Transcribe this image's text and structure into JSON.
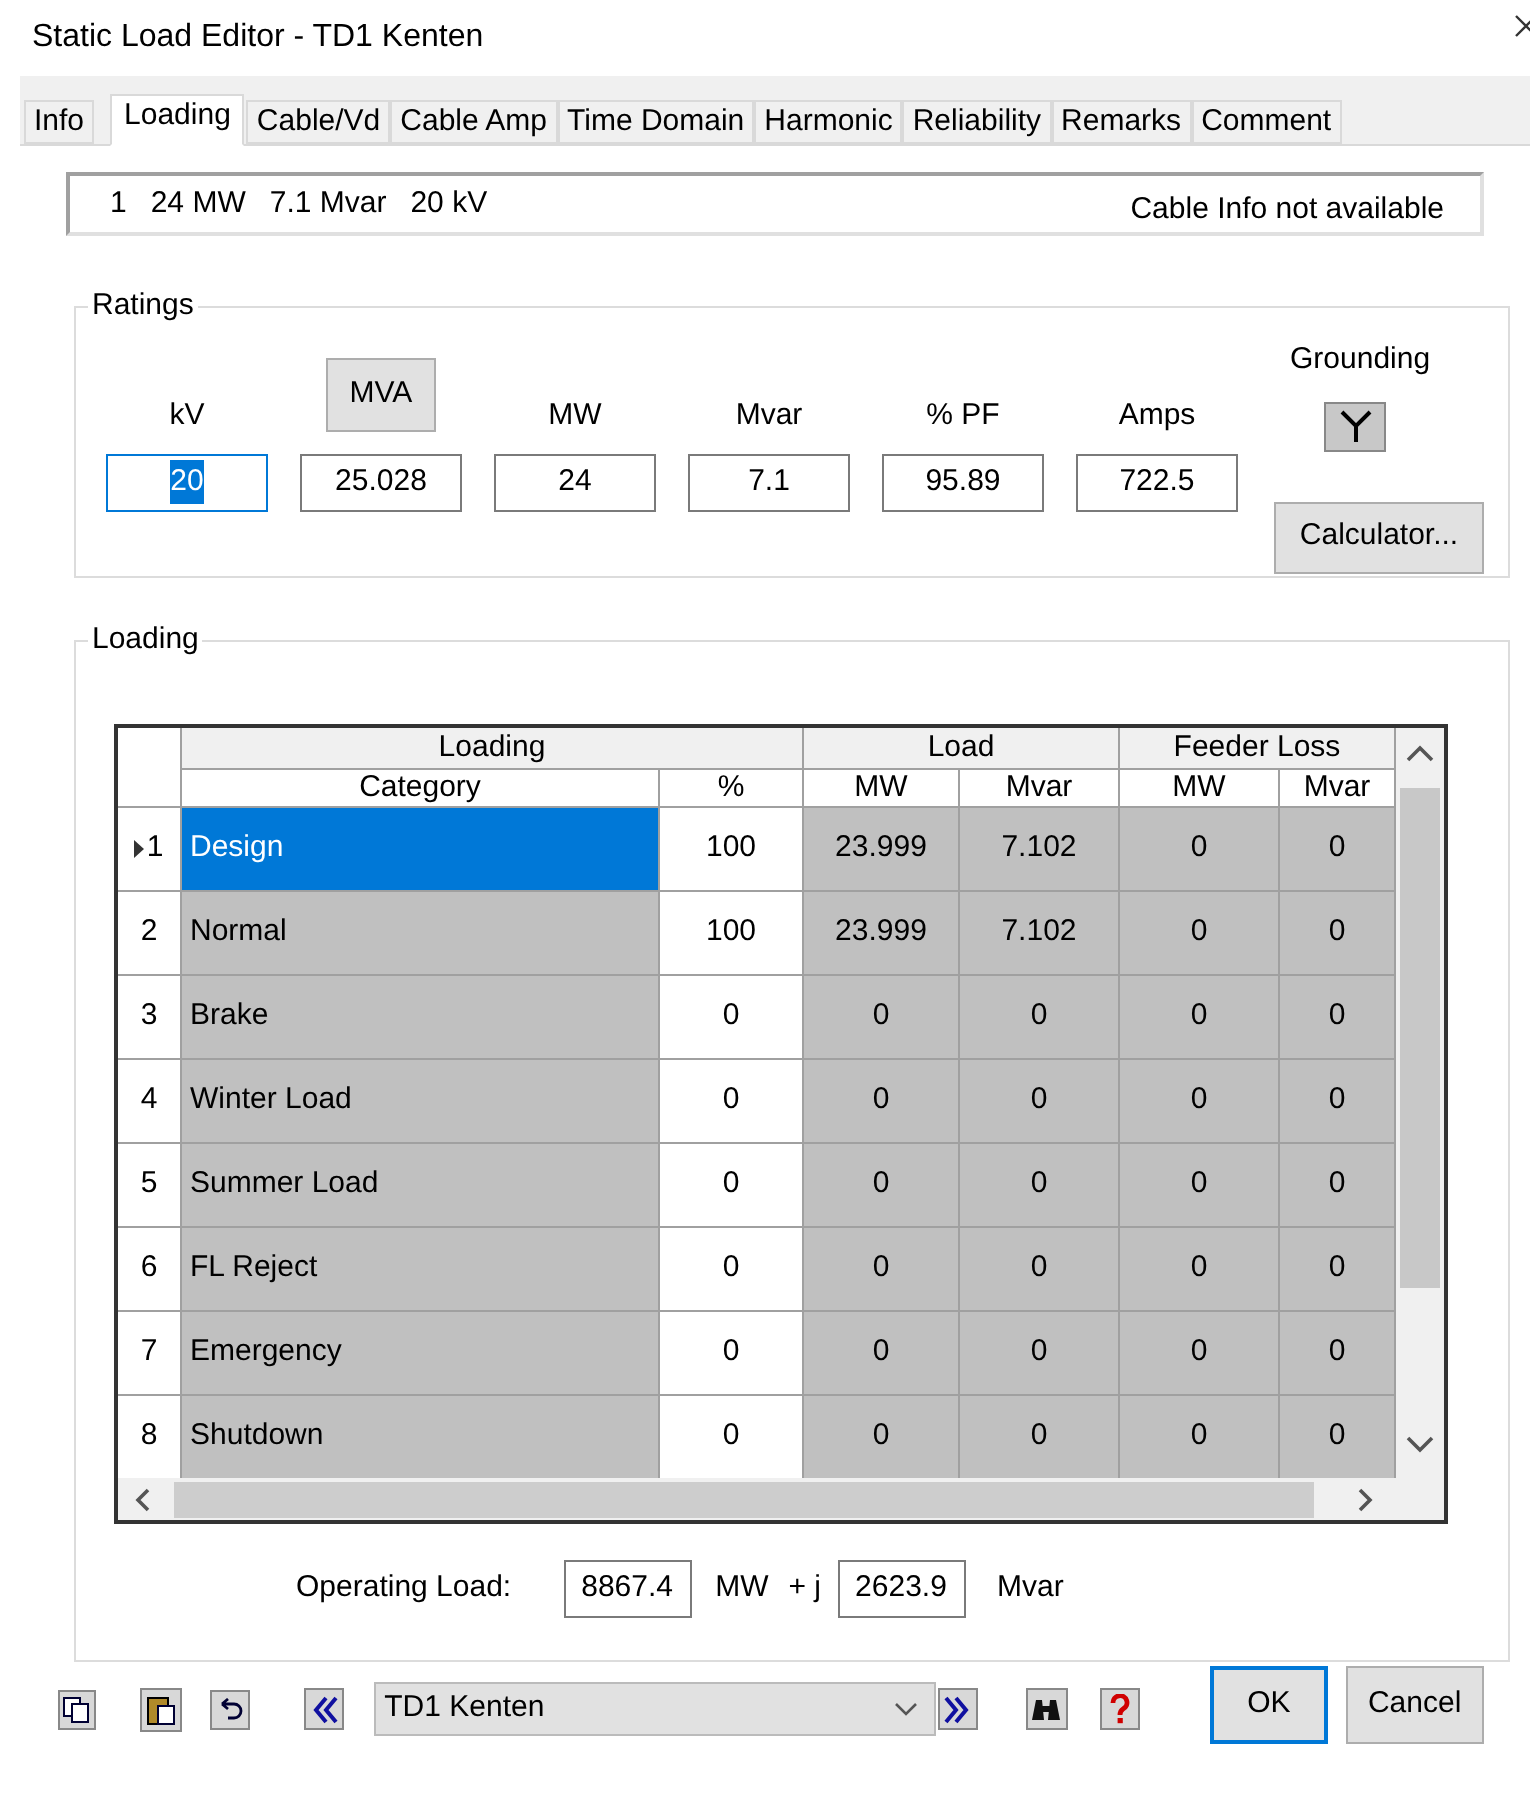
{
  "window": {
    "title": "Static Load Editor - TD1 Kenten"
  },
  "tabs": [
    {
      "label": "Info",
      "selected": false
    },
    {
      "label": "Loading",
      "selected": true
    },
    {
      "label": "Cable/Vd",
      "selected": false
    },
    {
      "label": "Cable Amp",
      "selected": false
    },
    {
      "label": "Time Domain",
      "selected": false
    },
    {
      "label": "Harmonic",
      "selected": false
    },
    {
      "label": "Reliability",
      "selected": false
    },
    {
      "label": "Remarks",
      "selected": false
    },
    {
      "label": "Comment",
      "selected": false
    }
  ],
  "info_bar": {
    "items": [
      "1",
      "24 MW",
      "7.1 Mvar",
      "20 kV"
    ],
    "note": "Cable Info not available"
  },
  "ratings": {
    "title": "Ratings",
    "fields": [
      {
        "label": "kV",
        "kind": "text",
        "value": "20",
        "selected": true
      },
      {
        "label": "MVA",
        "kind": "button",
        "value": "25.028",
        "selected": false
      },
      {
        "label": "MW",
        "kind": "text",
        "value": "24",
        "selected": false
      },
      {
        "label": "Mvar",
        "kind": "text",
        "value": "7.1",
        "selected": false
      },
      {
        "label": "% PF",
        "kind": "text",
        "value": "95.89",
        "selected": false
      },
      {
        "label": "Amps",
        "kind": "text",
        "value": "722.5",
        "selected": false
      }
    ],
    "grounding_label": "Grounding",
    "calculator_button": "Calculator..."
  },
  "loading": {
    "title": "Loading",
    "group_headers": [
      "Loading",
      "Load",
      "Feeder Loss"
    ],
    "columns": [
      "Category",
      "%",
      "MW",
      "Mvar",
      "MW",
      "Mvar"
    ],
    "rows": [
      {
        "number": "1",
        "selected": true,
        "cells": [
          "Design",
          "100",
          "23.999",
          "7.102",
          "0",
          "0"
        ]
      },
      {
        "number": "2",
        "selected": false,
        "cells": [
          "Normal",
          "100",
          "23.999",
          "7.102",
          "0",
          "0"
        ]
      },
      {
        "number": "3",
        "selected": false,
        "cells": [
          "Brake",
          "0",
          "0",
          "0",
          "0",
          "0"
        ]
      },
      {
        "number": "4",
        "selected": false,
        "cells": [
          "Winter Load",
          "0",
          "0",
          "0",
          "0",
          "0"
        ]
      },
      {
        "number": "5",
        "selected": false,
        "cells": [
          "Summer Load",
          "0",
          "0",
          "0",
          "0",
          "0"
        ]
      },
      {
        "number": "6",
        "selected": false,
        "cells": [
          "FL Reject",
          "0",
          "0",
          "0",
          "0",
          "0"
        ]
      },
      {
        "number": "7",
        "selected": false,
        "cells": [
          "Emergency",
          "0",
          "0",
          "0",
          "0",
          "0"
        ]
      },
      {
        "number": "8",
        "selected": false,
        "cells": [
          "Shutdown",
          "0",
          "0",
          "0",
          "0",
          "0"
        ]
      }
    ],
    "operating_load": {
      "label": "Operating Load:",
      "mw": "8867.4",
      "mw_unit": "MW",
      "j": "+ j",
      "mvar": "2623.9",
      "mvar_unit": "Mvar"
    }
  },
  "footer": {
    "record": "TD1 Kenten",
    "ok_button": "OK",
    "cancel_button": "Cancel"
  }
}
